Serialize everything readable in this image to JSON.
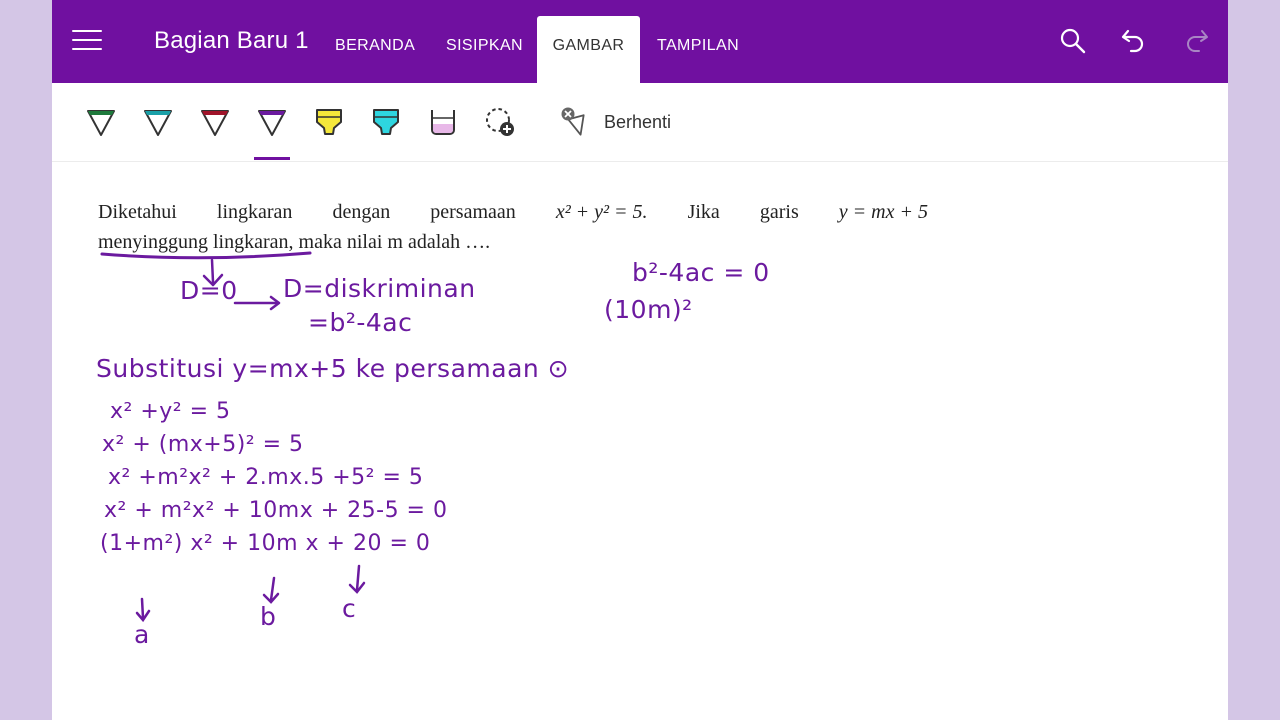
{
  "app": {
    "section_title": "Bagian Baru 1",
    "tabs": [
      {
        "label": "BERANDA",
        "active": false
      },
      {
        "label": "SISIPKAN",
        "active": false
      },
      {
        "label": "GAMBAR",
        "active": true
      },
      {
        "label": "TAMPILAN",
        "active": false
      }
    ],
    "icons": [
      "menu-icon",
      "search-icon",
      "undo-icon",
      "redo-icon"
    ]
  },
  "toolbar": {
    "pens": [
      {
        "name": "pen-green",
        "color": "#1e7a3c"
      },
      {
        "name": "pen-teal",
        "color": "#1aa0a8"
      },
      {
        "name": "pen-red",
        "color": "#a0142a"
      },
      {
        "name": "pen-purple",
        "color": "#6b1a9f",
        "selected": true
      },
      {
        "name": "highlighter-yellow",
        "color": "#f5e83a"
      },
      {
        "name": "highlighter-cyan",
        "color": "#2ed6e0"
      },
      {
        "name": "highlighter-pink",
        "color": "#e8b8e8"
      }
    ],
    "stop_label": "Berhenti"
  },
  "problem": {
    "line1_words": [
      "Diketahui",
      "lingkaran",
      "dengan",
      "persamaan"
    ],
    "equation1": "x² + y² = 5.",
    "line1_tail": [
      "Jika",
      "garis"
    ],
    "equation2": "y = mx + 5",
    "line2_underlined": "menyinggung lingkaran",
    "line2_rest": ", maka nilai m adalah …."
  },
  "handwriting": {
    "d_eq": "D=0",
    "d_def": "D=diskriminan",
    "d_formula": "=b²-4ac",
    "disc_right": "b²-4ac = 0",
    "disc_right2": "(10m)²",
    "subst": "Substitusi  y=mx+5   ke persamaan ⊙",
    "steps": [
      "x² +y² = 5",
      "x² + (mx+5)² = 5",
      "x² +m²x² + 2.mx.5 +5² = 5",
      "x² + m²x² + 10mx + 25-5 = 0",
      "(1+m²) x²  +  10m x + 20 = 0"
    ],
    "label_a": "a",
    "label_b": "b",
    "label_c": "c"
  },
  "colors": {
    "brand": "#7010a0",
    "ink": "#6b1a9f",
    "side_bg": "#d4c6e6"
  }
}
